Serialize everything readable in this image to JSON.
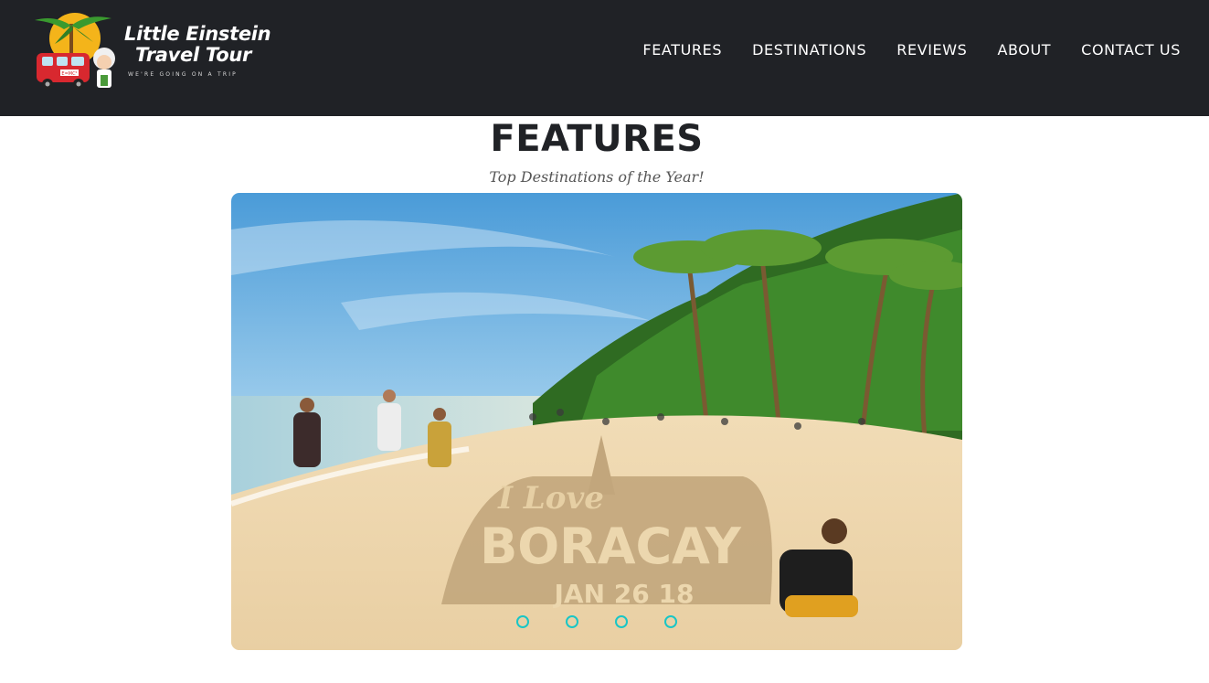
{
  "brand": {
    "title_line1": "Little Einstein",
    "title_line2": "Travel Tour",
    "tagline": "WE'RE GOING ON A TRIP",
    "van_plate": "E=MC²"
  },
  "nav": {
    "items": [
      {
        "label": "FEATURES"
      },
      {
        "label": "DESTINATIONS"
      },
      {
        "label": "REVIEWS"
      },
      {
        "label": "ABOUT"
      },
      {
        "label": "CONTACT US"
      }
    ]
  },
  "section": {
    "title": "FEATURES",
    "subtitle": "Top Destinations of the Year!"
  },
  "carousel": {
    "slide_text": {
      "line1": "I Love",
      "line2": "BORACAY",
      "line3": "JAN 26 18"
    },
    "indicator_count": 4,
    "active_index": 0
  },
  "colors": {
    "navbar_bg": "#202226",
    "indicator": "#19c6c6",
    "title": "#202226",
    "subtitle": "#555555"
  }
}
